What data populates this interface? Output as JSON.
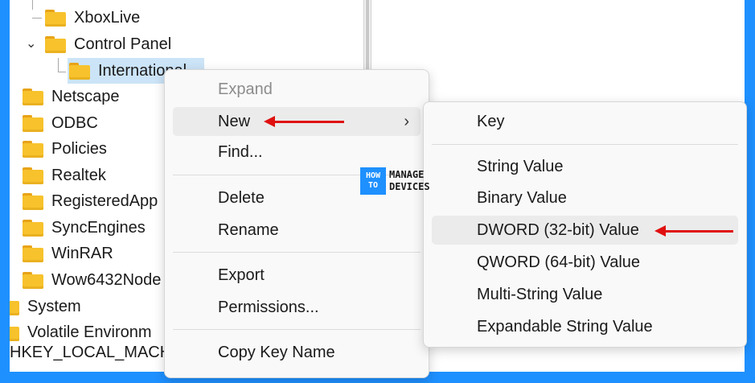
{
  "tree": {
    "items": [
      {
        "label": "XboxLive"
      },
      {
        "label": "Control Panel"
      },
      {
        "label": "International"
      },
      {
        "label": "Netscape"
      },
      {
        "label": "ODBC"
      },
      {
        "label": "Policies"
      },
      {
        "label": "Realtek"
      },
      {
        "label": "RegisteredApp"
      },
      {
        "label": "SyncEngines"
      },
      {
        "label": "WinRAR"
      },
      {
        "label": "Wow6432Node"
      },
      {
        "label": "System"
      },
      {
        "label": "Volatile Environm"
      },
      {
        "label": "HKEY_LOCAL_MACH"
      }
    ]
  },
  "context_menu": {
    "expand": "Expand",
    "new": "New",
    "find": "Find...",
    "delete": "Delete",
    "rename": "Rename",
    "export": "Export",
    "permissions": "Permissions...",
    "copy_key_name": "Copy Key Name",
    "submenu_arrow": "›"
  },
  "new_submenu": {
    "key": "Key",
    "string_value": "String Value",
    "binary_value": "Binary Value",
    "dword_value": "DWORD (32-bit) Value",
    "qword_value": "QWORD (64-bit) Value",
    "multi_string_value": "Multi-String Value",
    "expandable_string_value": "Expandable String Value"
  },
  "watermark": {
    "line1": "HOW",
    "line2": "TO",
    "word1": "MANAGE",
    "word2": "DEVICES"
  },
  "icons": {
    "folder": "folder-icon",
    "chevron": "chevron-icon",
    "arrow": "red-arrow-icon"
  },
  "colors": {
    "border": "#1e90ff",
    "folder": "#f7c22c",
    "arrow": "#e01010",
    "hover": "#ebebeb"
  }
}
